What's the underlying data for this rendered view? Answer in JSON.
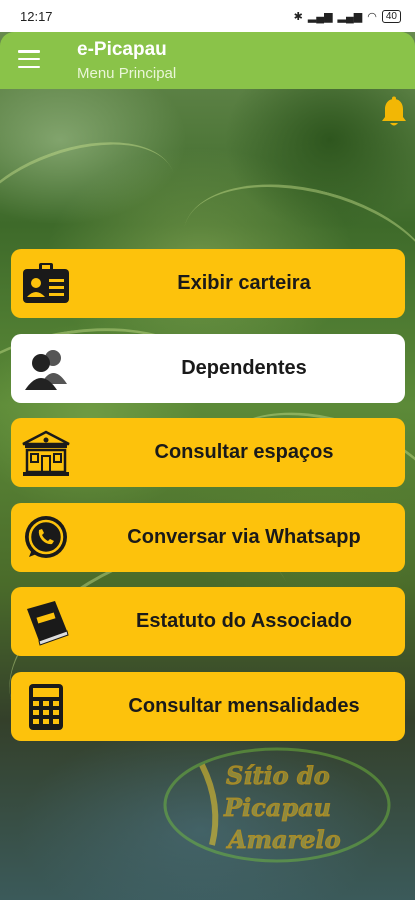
{
  "status_bar": {
    "time": "12:17",
    "battery": "40"
  },
  "app_bar": {
    "title": "e-Picapau",
    "subtitle": "Menu Principal"
  },
  "menu": [
    {
      "label": "Exibir carteira",
      "icon": "id-card-icon"
    },
    {
      "label": "Dependentes",
      "icon": "users-icon"
    },
    {
      "label": "Consultar espaços",
      "icon": "building-icon"
    },
    {
      "label": "Conversar via Whatsapp",
      "icon": "whatsapp-icon"
    },
    {
      "label": "Estatuto do Associado",
      "icon": "book-icon"
    },
    {
      "label": "Consultar mensalidades",
      "icon": "calculator-icon"
    }
  ],
  "logo": {
    "line1": "Sítio do",
    "line2": "Picapau",
    "line3": "Amarelo"
  },
  "colors": {
    "app_bar": "#8ac349",
    "button": "#fdc20c",
    "button_active": "#ffffff",
    "bell": "#f2b705"
  }
}
